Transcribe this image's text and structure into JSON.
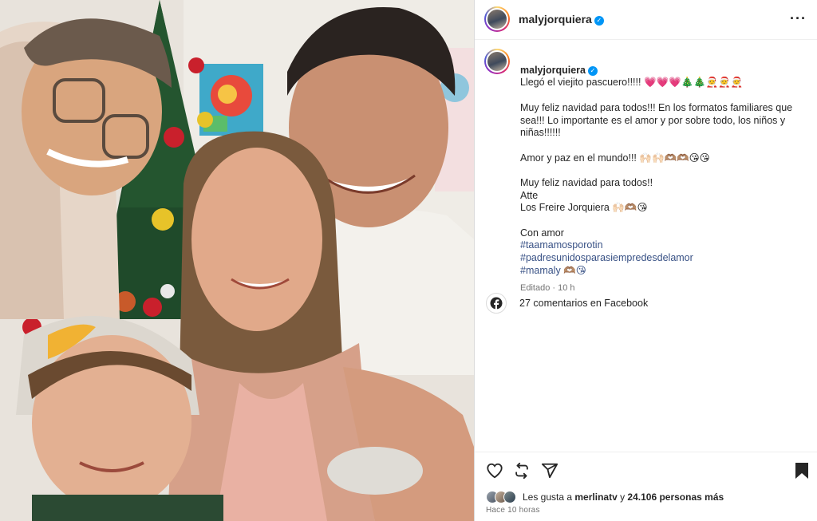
{
  "post": {
    "username": "malyjorquiera",
    "verified_mark": "✓",
    "more_icon": "more-dots-icon"
  },
  "caption": {
    "username": "malyjorquiera",
    "first_line": "Llegó el viejito pascuero!!!!! 💗💗💗🎄🎄🧑‍🎄🧑‍🎄🧑‍🎄",
    "paragraph_1": "Muy feliz navidad para todos!!! En los formatos familiares que sea!!! Lo importante es el amor y por sobre todo, los niños y niñas!!!!!!",
    "paragraph_2": "Amor y paz en el mundo!!! 🙌🏻🙌🏻🫶🏽🫶🏽😘😘",
    "paragraph_3a": "Muy feliz navidad para todos!!",
    "paragraph_3b": "Atte",
    "paragraph_3c": "Los Freire Jorquiera 🙌🏻🫶🏽😘",
    "closing": "Con amor",
    "hashtags": [
      "#taamamosporotin",
      "#padresunidosparasiempredesdelamor",
      "#mamaly 🫶🏽😘"
    ],
    "meta": "Editado · 10 h"
  },
  "facebook": {
    "text": "27 comentarios en Facebook",
    "icon": "facebook-icon"
  },
  "actions": {
    "like_icon": "heart-icon",
    "repost_icon": "repost-icon",
    "share_icon": "share-icon",
    "save_icon": "bookmark-icon"
  },
  "likes": {
    "prefix": "Les gusta a ",
    "user": "merlinatv",
    "middle": " y ",
    "count": "24.106 personas más"
  },
  "timestamp": "Hace 10 horas",
  "colors": {
    "link": "#385185",
    "verified": "#0095f6",
    "muted": "#737373",
    "border": "#dbdbdb"
  }
}
